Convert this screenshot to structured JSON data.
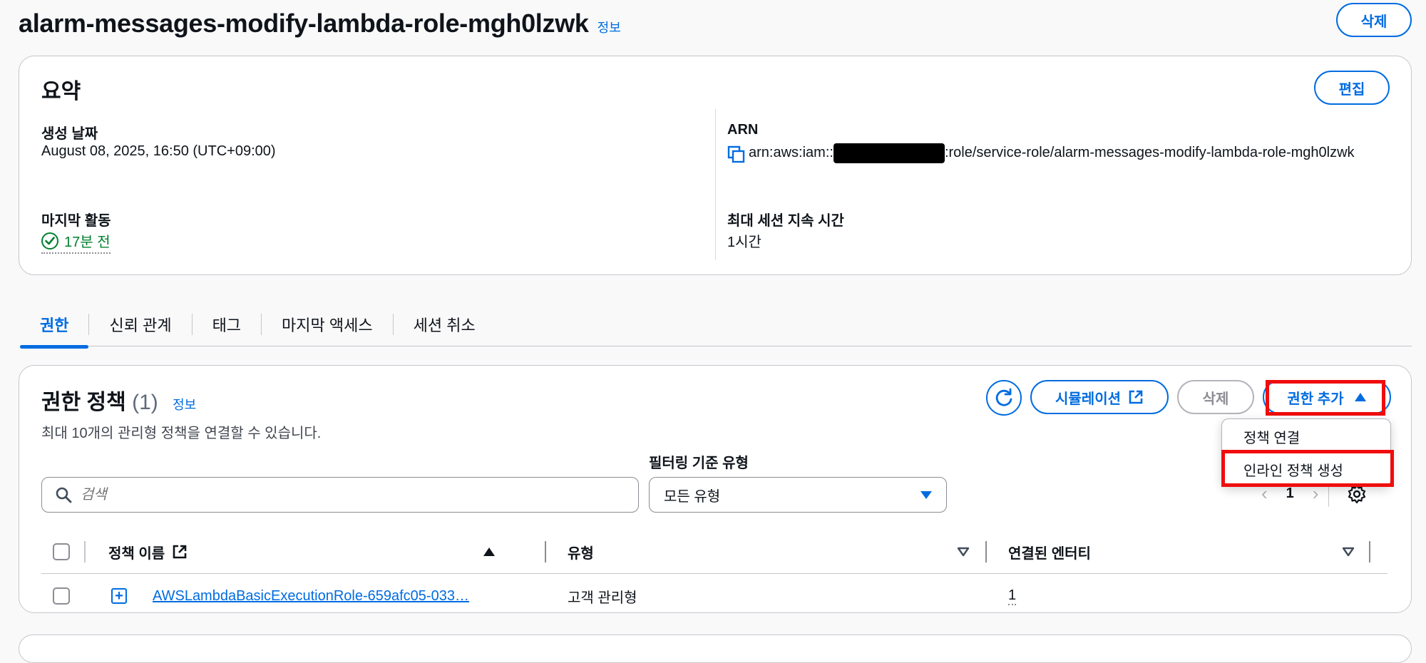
{
  "header": {
    "title": "alarm-messages-modify-lambda-role-mgh0lzwk",
    "info": "정보",
    "delete_label": "삭제"
  },
  "summary": {
    "title": "요약",
    "edit_label": "편집",
    "created_label": "생성 날짜",
    "created_value": "August 08, 2025, 16:50 (UTC+09:00)",
    "last_activity_label": "마지막 활동",
    "last_activity_value": "17분 전",
    "arn_label": "ARN",
    "arn_prefix": "arn:aws:iam::",
    "arn_suffix": ":role/service-role/alarm-messages-modify-lambda-role-mgh0lzwk",
    "max_session_label": "최대 세션 지속 시간",
    "max_session_value": "1시간"
  },
  "tabs": [
    {
      "label": "권한",
      "active": true
    },
    {
      "label": "신뢰 관계",
      "active": false
    },
    {
      "label": "태그",
      "active": false
    },
    {
      "label": "마지막 액세스",
      "active": false
    },
    {
      "label": "세션 취소",
      "active": false
    }
  ],
  "permissions": {
    "title": "권한 정책",
    "count": "(1)",
    "info": "정보",
    "description": "최대 10개의 관리형 정책을 연결할 수 있습니다.",
    "simulation_label": "시뮬레이션",
    "delete_label": "삭제",
    "add_label": "권한 추가",
    "dropdown": [
      "정책 연결",
      "인라인 정책 생성"
    ],
    "filter_label": "필터링 기준 유형",
    "search_placeholder": "검색",
    "select_value": "모든 유형",
    "page": "1",
    "columns": [
      "정책 이름",
      "유형",
      "연결된 엔터티"
    ],
    "rows": [
      {
        "name": "AWSLambdaBasicExecutionRole-659afc05-033…",
        "type": "고객 관리형",
        "entities": "1"
      }
    ]
  },
  "colors": {
    "accent": "#006ce0",
    "success": "#00802f",
    "highlight": "#f00d0d"
  }
}
